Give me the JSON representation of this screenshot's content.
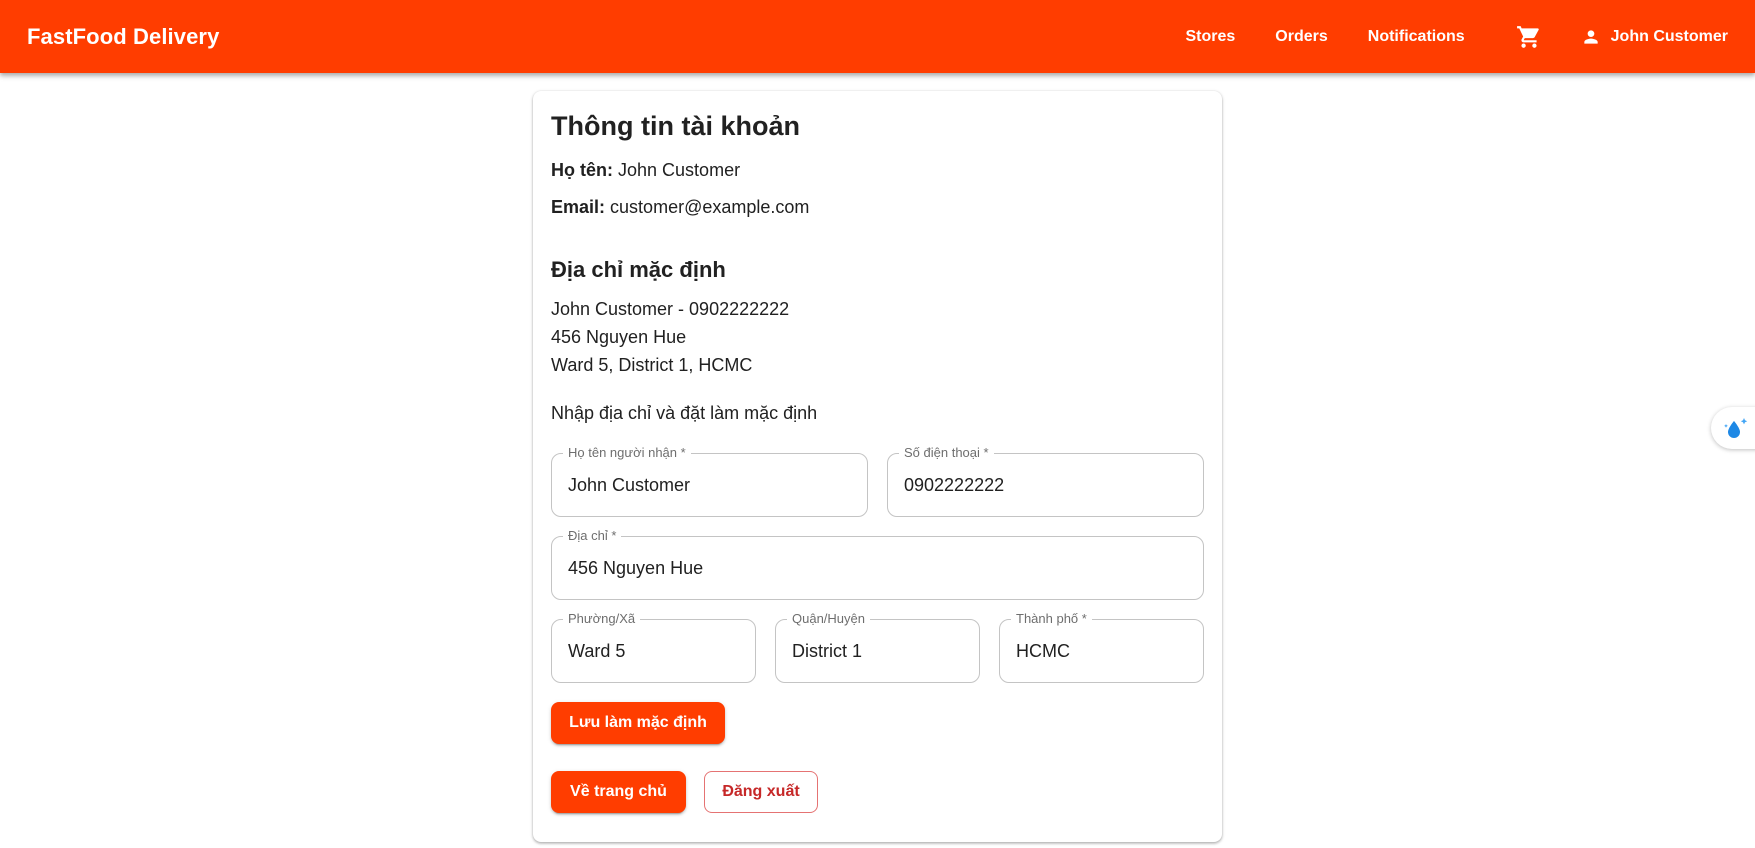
{
  "app": {
    "brand": "FastFood Delivery",
    "nav": {
      "stores": "Stores",
      "orders": "Orders",
      "notifications": "Notifications",
      "cart_icon": "cart-icon",
      "user_icon": "person-icon",
      "user_name": "John Customer"
    },
    "colors": {
      "primary": "#ff3d00",
      "danger": "#c62828"
    }
  },
  "account": {
    "title": "Thông tin tài khoản",
    "name_label": "Họ tên:",
    "name_value": "John Customer",
    "email_label": "Email:",
    "email_value": "customer@example.com"
  },
  "default_address": {
    "title": "Địa chỉ mặc định",
    "line1": "John Customer - 0902222222",
    "line2": "456 Nguyen Hue",
    "line3": "Ward 5, District 1, HCMC"
  },
  "form": {
    "hint": "Nhập địa chỉ và đặt làm mặc định",
    "recipient": {
      "label": "Họ tên người nhận *",
      "value": "John Customer"
    },
    "phone": {
      "label": "Số điện thoại *",
      "value": "0902222222"
    },
    "address": {
      "label": "Địa chỉ *",
      "value": "456 Nguyen Hue"
    },
    "ward": {
      "label": "Phường/Xã",
      "value": "Ward 5"
    },
    "district": {
      "label": "Quận/Huyện",
      "value": "District 1"
    },
    "city": {
      "label": "Thành phố *",
      "value": "HCMC"
    },
    "save_label": "Lưu làm mặc định"
  },
  "actions": {
    "home_label": "Về trang chủ",
    "logout_label": "Đăng xuất"
  },
  "side_widget": {
    "icon": "water-drop-sparkle-icon"
  }
}
